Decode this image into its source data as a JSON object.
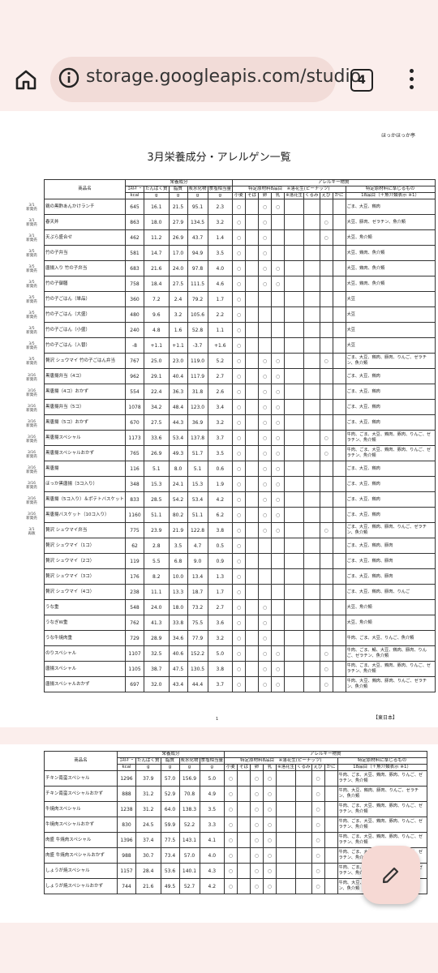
{
  "browser": {
    "url": "storage.googleapis.com/studio",
    "tab_count": "4"
  },
  "doc": {
    "brand": "ほっかほっか亭",
    "title": "3月栄養成分・アレルゲン一覧",
    "page_number": "1",
    "region": "【東日本】",
    "headers": {
      "product": "商品名",
      "nutrition": "栄養成分",
      "allergy": "アレルギー物質",
      "specific": "特定原材料8品目　※落花生(ピーナッツ)",
      "related": "特定原材料に準じるもの",
      "energy": "ｴﾈﾙｷﾞｰ",
      "protein": "たんぱく質",
      "fat": "脂質",
      "carb": "炭水化物",
      "salt": "食塩相当量",
      "u_kcal": "kcal",
      "u_g1": "g",
      "u_g2": "g",
      "u_g3": "g",
      "u_g4": "g",
      "wheat": "小麦",
      "soba": "そば",
      "egg": "卵",
      "milk": "乳",
      "peanut": "※落花生",
      "walnut": "くるみ",
      "shrimp": "えび",
      "crab": "かに",
      "eighteen": "18品目（＋魚介類表示 ※1）"
    },
    "dates": [
      {
        "d": "3/1",
        "n": "新発売"
      },
      {
        "d": "3/1",
        "n": "新発売"
      },
      {
        "d": "3/1",
        "n": "新発売"
      },
      {
        "d": "3/5",
        "n": "新発売"
      },
      {
        "d": "3/5",
        "n": "新発売"
      },
      {
        "d": "3/5",
        "n": "新発売"
      },
      {
        "d": "3/5",
        "n": "新発売"
      },
      {
        "d": "3/5",
        "n": "新発売"
      },
      {
        "d": "3/5",
        "n": "新発売"
      },
      {
        "d": "3/5",
        "n": "新発売"
      },
      {
        "d": "3/5",
        "n": "新発売"
      },
      {
        "d": "3/16",
        "n": "新発売"
      },
      {
        "d": "3/16",
        "n": "新発売"
      },
      {
        "d": "3/16",
        "n": "新発売"
      },
      {
        "d": "3/16",
        "n": "新発売"
      },
      {
        "d": "3/16",
        "n": "新発売"
      },
      {
        "d": "3/16",
        "n": "新発売"
      },
      {
        "d": "3/16",
        "n": "新発売"
      },
      {
        "d": "3/16",
        "n": "新発売"
      },
      {
        "d": "3/16",
        "n": "新発売"
      },
      {
        "d": "3/16",
        "n": "新発売"
      },
      {
        "d": "3/1",
        "n": "再販"
      }
    ],
    "rows": [
      {
        "name": "鶏の黒酢あんかけランチ",
        "kcal": "645",
        "p": "16.1",
        "f": "21.5",
        "c": "95.1",
        "s": "2.3",
        "m": [
          1,
          0,
          1,
          1,
          0,
          0,
          0,
          0
        ],
        "notes": "ごま、大豆、鶏肉"
      },
      {
        "name": "春天丼",
        "kcal": "863",
        "p": "18.0",
        "f": "27.9",
        "c": "134.5",
        "s": "3.2",
        "m": [
          1,
          0,
          1,
          0,
          0,
          0,
          1,
          0
        ],
        "notes": "大豆、豚肉、ゼラチン、魚介類"
      },
      {
        "name": "天ぷら盛合せ",
        "kcal": "462",
        "p": "11.2",
        "f": "26.9",
        "c": "43.7",
        "s": "1.4",
        "m": [
          1,
          0,
          1,
          0,
          0,
          0,
          1,
          0
        ],
        "notes": "大豆、魚介類"
      },
      {
        "name": "竹の子弁当",
        "kcal": "581",
        "p": "14.7",
        "f": "17.0",
        "c": "94.9",
        "s": "3.5",
        "m": [
          1,
          0,
          1,
          0,
          0,
          0,
          0,
          0
        ],
        "notes": "大豆、鶏肉、魚介類"
      },
      {
        "name": "唐揚入り 竹の子弁当",
        "kcal": "683",
        "p": "21.6",
        "f": "24.0",
        "c": "97.8",
        "s": "4.0",
        "m": [
          1,
          0,
          1,
          1,
          0,
          0,
          0,
          0
        ],
        "notes": "大豆、鶏肉、魚介類"
      },
      {
        "name": "竹の子御膳",
        "kcal": "758",
        "p": "18.4",
        "f": "27.5",
        "c": "111.5",
        "s": "4.6",
        "m": [
          1,
          0,
          1,
          1,
          0,
          0,
          0,
          0
        ],
        "notes": "大豆、鶏肉、魚介類"
      },
      {
        "name": "竹の子ごはん（単品）",
        "kcal": "360",
        "p": "7.2",
        "f": "2.4",
        "c": "79.2",
        "s": "1.7",
        "m": [
          1,
          0,
          0,
          0,
          0,
          0,
          0,
          0
        ],
        "notes": "大豆"
      },
      {
        "name": "竹の子ごはん（大盛）",
        "kcal": "480",
        "p": "9.6",
        "f": "3.2",
        "c": "105.6",
        "s": "2.2",
        "m": [
          1,
          0,
          0,
          0,
          0,
          0,
          0,
          0
        ],
        "notes": "大豆"
      },
      {
        "name": "竹の子ごはん（小盛）",
        "kcal": "240",
        "p": "4.8",
        "f": "1.6",
        "c": "52.8",
        "s": "1.1",
        "m": [
          1,
          0,
          0,
          0,
          0,
          0,
          0,
          0
        ],
        "notes": "大豆"
      },
      {
        "name": "竹の子ごはん（入替）",
        "kcal": "-8",
        "p": "+1.1",
        "f": "+1.1",
        "c": "-3.7",
        "s": "+1.6",
        "m": [
          1,
          0,
          0,
          0,
          0,
          0,
          0,
          0
        ],
        "notes": "大豆"
      },
      {
        "name": "贅沢 シュウマイ 竹の子ごはん弁当",
        "kcal": "767",
        "p": "25.0",
        "f": "23.0",
        "c": "119.0",
        "s": "5.2",
        "m": [
          1,
          0,
          1,
          1,
          0,
          0,
          1,
          0
        ],
        "notes": "ごま、大豆、鶏肉、豚肉、りんご、ゼラチン、魚介類"
      },
      {
        "name": "黒唐揚弁当（4コ）",
        "kcal": "962",
        "p": "29.1",
        "f": "40.4",
        "c": "117.9",
        "s": "2.7",
        "m": [
          1,
          0,
          1,
          1,
          0,
          0,
          0,
          0
        ],
        "notes": "ごま、大豆、鶏肉"
      },
      {
        "name": "黒唐揚（4コ）おかず",
        "kcal": "554",
        "p": "22.4",
        "f": "36.3",
        "c": "31.8",
        "s": "2.6",
        "m": [
          1,
          0,
          1,
          1,
          0,
          0,
          0,
          0
        ],
        "notes": "ごま、大豆、鶏肉"
      },
      {
        "name": "黒唐揚弁当（5コ）",
        "kcal": "1078",
        "p": "34.2",
        "f": "48.4",
        "c": "123.0",
        "s": "3.4",
        "m": [
          1,
          0,
          1,
          1,
          0,
          0,
          0,
          0
        ],
        "notes": "ごま、大豆、鶏肉"
      },
      {
        "name": "黒唐揚（5コ）おかず",
        "kcal": "670",
        "p": "27.5",
        "f": "44.3",
        "c": "36.9",
        "s": "3.2",
        "m": [
          1,
          0,
          1,
          1,
          0,
          0,
          0,
          0
        ],
        "notes": "ごま、大豆、鶏肉"
      },
      {
        "name": "黒唐揚スペシャル",
        "kcal": "1173",
        "p": "33.6",
        "f": "53.4",
        "c": "137.8",
        "s": "3.7",
        "m": [
          1,
          0,
          1,
          1,
          0,
          0,
          1,
          0
        ],
        "notes": "牛肉、ごま、大豆、鶏肉、豚肉、りんご、ゼラチン、魚介類"
      },
      {
        "name": "黒唐揚スペシャルおかず",
        "kcal": "765",
        "p": "26.9",
        "f": "49.3",
        "c": "51.7",
        "s": "3.5",
        "m": [
          1,
          0,
          1,
          1,
          0,
          0,
          1,
          0
        ],
        "notes": "牛肉、ごま、大豆、鶏肉、豚肉、りんご、ゼラチン、魚介類"
      },
      {
        "name": "黒唐揚",
        "kcal": "116",
        "p": "5.1",
        "f": "8.0",
        "c": "5.1",
        "s": "0.6",
        "m": [
          1,
          0,
          1,
          1,
          0,
          0,
          0,
          0
        ],
        "notes": "ごま、大豆、鶏肉"
      },
      {
        "name": "ほっか黒唐揚（3コ入り）",
        "kcal": "348",
        "p": "15.3",
        "f": "24.1",
        "c": "15.3",
        "s": "1.9",
        "m": [
          1,
          0,
          1,
          1,
          0,
          0,
          0,
          0
        ],
        "notes": "ごま、大豆、鶏肉"
      },
      {
        "name": "黒唐揚（5コ入り）＆ポテトバスケット",
        "kcal": "833",
        "p": "28.5",
        "f": "54.2",
        "c": "53.4",
        "s": "4.2",
        "m": [
          1,
          0,
          1,
          1,
          0,
          0,
          0,
          0
        ],
        "notes": "ごま、大豆、鶏肉"
      },
      {
        "name": "黒唐揚バスケット（10コ入り）",
        "kcal": "1160",
        "p": "51.1",
        "f": "80.2",
        "c": "51.1",
        "s": "6.2",
        "m": [
          1,
          0,
          1,
          1,
          0,
          0,
          0,
          0
        ],
        "notes": "ごま、大豆、鶏肉"
      },
      {
        "name": "贅沢 シュウマイ弁当",
        "kcal": "775",
        "p": "23.9",
        "f": "21.9",
        "c": "122.8",
        "s": "3.8",
        "m": [
          1,
          0,
          1,
          1,
          0,
          0,
          1,
          0
        ],
        "notes": "ごま、大豆、鶏肉、豚肉、りんご、ゼラチン、魚介類"
      },
      {
        "name": "贅沢 シュウマイ（1コ）",
        "kcal": "62",
        "p": "2.8",
        "f": "3.5",
        "c": "4.7",
        "s": "0.5",
        "m": [
          1,
          0,
          0,
          0,
          0,
          0,
          0,
          0
        ],
        "notes": "ごま、大豆、鶏肉、豚肉"
      },
      {
        "name": "贅沢 シュウマイ（2コ）",
        "kcal": "119",
        "p": "5.5",
        "f": "6.8",
        "c": "9.0",
        "s": "0.9",
        "m": [
          1,
          0,
          0,
          0,
          0,
          0,
          0,
          0
        ],
        "notes": "ごま、大豆、鶏肉、豚肉"
      },
      {
        "name": "贅沢 シュウマイ（3コ）",
        "kcal": "176",
        "p": "8.2",
        "f": "10.0",
        "c": "13.4",
        "s": "1.3",
        "m": [
          1,
          0,
          0,
          0,
          0,
          0,
          0,
          0
        ],
        "notes": "ごま、大豆、鶏肉、豚肉"
      },
      {
        "name": "贅沢 シュウマイ（4コ）",
        "kcal": "238",
        "p": "11.1",
        "f": "13.3",
        "c": "18.7",
        "s": "1.7",
        "m": [
          1,
          0,
          0,
          0,
          0,
          0,
          0,
          0
        ],
        "notes": "ごま、大豆、鶏肉、豚肉、りんご"
      },
      {
        "name": "うな重",
        "kcal": "548",
        "p": "24.0",
        "f": "18.0",
        "c": "73.2",
        "s": "2.7",
        "m": [
          1,
          0,
          1,
          0,
          0,
          0,
          0,
          0
        ],
        "notes": "大豆、魚介類"
      },
      {
        "name": "うなぎW重",
        "kcal": "762",
        "p": "41.3",
        "f": "33.8",
        "c": "75.5",
        "s": "3.6",
        "m": [
          1,
          0,
          1,
          0,
          0,
          0,
          0,
          0
        ],
        "notes": "大豆、魚介類"
      },
      {
        "name": "うな牛焼肉重",
        "kcal": "729",
        "p": "28.9",
        "f": "34.6",
        "c": "77.9",
        "s": "3.2",
        "m": [
          1,
          0,
          1,
          0,
          0,
          0,
          0,
          0
        ],
        "notes": "牛肉、ごま、大豆、りんご、魚介類"
      },
      {
        "name": "のりスペシャル",
        "kcal": "1107",
        "p": "32.5",
        "f": "40.6",
        "c": "152.2",
        "s": "5.0",
        "m": [
          1,
          0,
          1,
          1,
          0,
          0,
          1,
          0
        ],
        "notes": "牛肉、ごま、鯖、大豆、鶏肉、豚肉、りんご、ゼラチン、魚介類"
      },
      {
        "name": "唐揚スペシャル",
        "kcal": "1105",
        "p": "38.7",
        "f": "47.5",
        "c": "130.5",
        "s": "3.8",
        "m": [
          1,
          0,
          1,
          1,
          0,
          0,
          1,
          0
        ],
        "notes": "牛肉、ごま、大豆、鶏肉、豚肉、りんご、ゼラチン、魚介類"
      },
      {
        "name": "唐揚スペシャルおかず",
        "kcal": "697",
        "p": "32.0",
        "f": "43.4",
        "c": "44.4",
        "s": "3.7",
        "m": [
          1,
          0,
          1,
          1,
          0,
          0,
          1,
          0
        ],
        "notes": "牛肉、大豆、鶏肉、豚肉、りんご、ゼラチン、魚介類"
      }
    ],
    "rows2": [
      {
        "name": "チキン南蛮スペシャル",
        "kcal": "1296",
        "p": "37.9",
        "f": "57.0",
        "c": "156.9",
        "s": "5.0",
        "m": [
          1,
          0,
          1,
          1,
          0,
          0,
          1,
          0
        ],
        "notes": "牛肉、ごま、大豆、鶏肉、豚肉、りんご、ゼラチン、魚介類"
      },
      {
        "name": "チキン南蛮スペシャルおかず",
        "kcal": "888",
        "p": "31.2",
        "f": "52.9",
        "c": "70.8",
        "s": "4.9",
        "m": [
          1,
          0,
          1,
          1,
          0,
          0,
          1,
          0
        ],
        "notes": "牛肉、大豆、鶏肉、豚肉、りんご、ゼラチン、魚介類"
      },
      {
        "name": "牛焼肉スペシャル",
        "kcal": "1238",
        "p": "31.2",
        "f": "64.0",
        "c": "138.3",
        "s": "3.5",
        "m": [
          1,
          0,
          1,
          1,
          0,
          0,
          1,
          0
        ],
        "notes": "牛肉、ごま、大豆、鶏肉、豚肉、りんご、ゼラチン、魚介類"
      },
      {
        "name": "牛焼肉スペシャルおかず",
        "kcal": "830",
        "p": "24.5",
        "f": "59.9",
        "c": "52.2",
        "s": "3.3",
        "m": [
          1,
          0,
          1,
          1,
          0,
          0,
          1,
          0
        ],
        "notes": "牛肉、ごま、大豆、鶏肉、豚肉、りんご、ゼラチン、魚介類"
      },
      {
        "name": "肉盛 牛焼肉スペシャル",
        "kcal": "1396",
        "p": "37.4",
        "f": "77.5",
        "c": "143.1",
        "s": "4.1",
        "m": [
          1,
          0,
          1,
          1,
          0,
          0,
          1,
          0
        ],
        "notes": "牛肉、ごま、大豆、鶏肉、豚肉、りんご、ゼラチン、魚介類"
      },
      {
        "name": "肉盛 牛焼肉スペシャルおかず",
        "kcal": "988",
        "p": "30.7",
        "f": "73.4",
        "c": "57.0",
        "s": "4.0",
        "m": [
          1,
          0,
          1,
          1,
          0,
          0,
          1,
          0
        ],
        "notes": "牛肉、ごま、大豆、鶏肉、豚肉、りんご、ゼラチン、魚介類"
      },
      {
        "name": "しょうが焼スペシャル",
        "kcal": "1157",
        "p": "28.4",
        "f": "53.6",
        "c": "140.1",
        "s": "4.3",
        "m": [
          1,
          0,
          1,
          1,
          0,
          0,
          1,
          0
        ],
        "notes": "牛肉、ごま、大豆、鶏肉、豚肉、りんご、ゼラチン、魚介類"
      },
      {
        "name": "しょうが焼スペシャルおかず",
        "kcal": "744",
        "p": "21.6",
        "f": "49.5",
        "c": "52.7",
        "s": "4.2",
        "m": [
          1,
          0,
          1,
          1,
          0,
          0,
          1,
          0
        ],
        "notes": "牛肉、大豆、鶏肉、豚肉、りんご、ゼラチン、魚介類"
      }
    ]
  }
}
